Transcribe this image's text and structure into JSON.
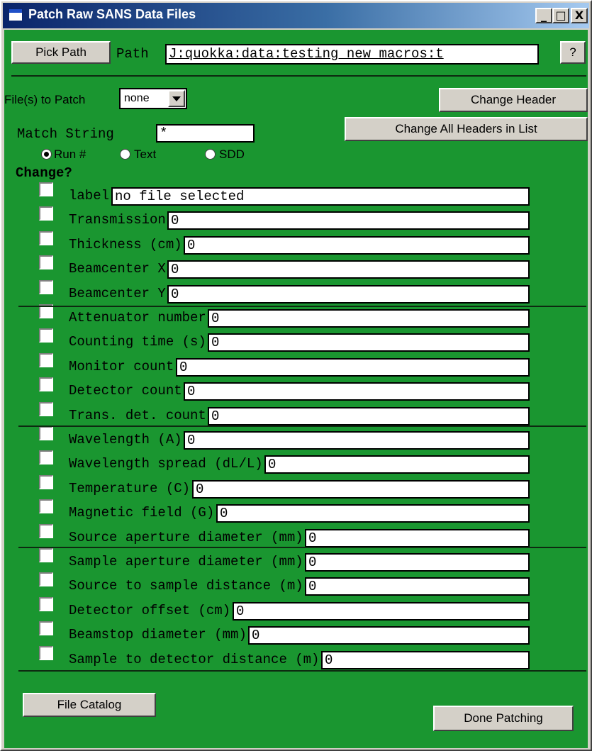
{
  "window": {
    "title": "Patch Raw SANS Data Files",
    "controls": {
      "minimize": "_",
      "maximize": "□",
      "close": "X"
    }
  },
  "colors": {
    "panel": "#1a9630",
    "titlebar": "#0a246a",
    "button_face": "#d4d0c8"
  },
  "path_row": {
    "pick_path_label": "Pick Path",
    "path_label": "Path",
    "path_value": "J:quokka:data:testing new macros:t",
    "help_label": "?"
  },
  "file_select": {
    "label": "File(s) to Patch",
    "value": "none",
    "change_header_label": "Change Header",
    "change_all_label": "Change All Headers in List"
  },
  "match": {
    "label": "Match String",
    "value": "*",
    "options": [
      {
        "label": "Run #",
        "selected": true
      },
      {
        "label": "Text",
        "selected": false
      },
      {
        "label": "SDD",
        "selected": false
      }
    ]
  },
  "change_heading": "Change?",
  "fields": [
    {
      "label": "label",
      "value": "no file selected"
    },
    {
      "label": "Transmission",
      "value": "0"
    },
    {
      "label": "Thickness (cm)",
      "value": "0"
    },
    {
      "label": "Beamcenter X",
      "value": "0"
    },
    {
      "label": "Beamcenter Y",
      "value": "0"
    },
    {
      "label": "Attenuator number",
      "value": "0"
    },
    {
      "label": "Counting time (s)",
      "value": "0"
    },
    {
      "label": "Monitor count",
      "value": "0"
    },
    {
      "label": "Detector count",
      "value": "0"
    },
    {
      "label": "Trans. det. count",
      "value": "0"
    },
    {
      "label": "Wavelength (A)",
      "value": "0"
    },
    {
      "label": "Wavelength spread (dL/L)",
      "value": "0"
    },
    {
      "label": "Temperature (C)",
      "value": "0"
    },
    {
      "label": "Magnetic field (G)",
      "value": "0"
    },
    {
      "label": "Source aperture diameter (mm)",
      "value": "0"
    },
    {
      "label": "Sample aperture diameter (mm)",
      "value": "0"
    },
    {
      "label": "Source to sample distance (m)",
      "value": "0"
    },
    {
      "label": "Detector offset (cm)",
      "value": "0"
    },
    {
      "label": "Beamstop diameter (mm)",
      "value": "0"
    },
    {
      "label": "Sample to detector distance (m)",
      "value": "0"
    }
  ],
  "bottom": {
    "file_catalog_label": "File Catalog",
    "done_label": "Done Patching"
  }
}
